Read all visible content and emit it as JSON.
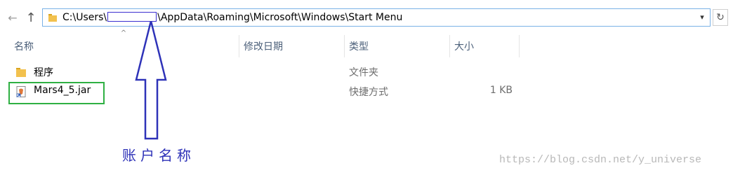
{
  "address_bar": {
    "path_prefix": "C:\\Users\\",
    "path_suffix": "\\AppData\\Roaming\\Microsoft\\Windows\\Start Menu"
  },
  "columns": [
    {
      "label": "名称"
    },
    {
      "label": "修改日期"
    },
    {
      "label": "类型"
    },
    {
      "label": "大小"
    }
  ],
  "rows": [
    {
      "name": "程序",
      "type": "文件夹",
      "size": ""
    },
    {
      "name": "Mars4_5.jar",
      "type": "快捷方式",
      "size": "1 KB"
    }
  ],
  "annotation": {
    "label": "账户名称"
  },
  "watermark": "https://blog.csdn.net/y_universe",
  "colors": {
    "annotation": "#2e32b8",
    "highlight_box": "#2fb043",
    "address_border": "#7ab2e6"
  },
  "icons": {
    "back": "arrow-left-icon",
    "up": "arrow-up-icon",
    "folder": "folder-icon",
    "shortcut": "jar-shortcut-icon",
    "dropdown": "chevron-down-icon",
    "refresh": "refresh-icon"
  }
}
